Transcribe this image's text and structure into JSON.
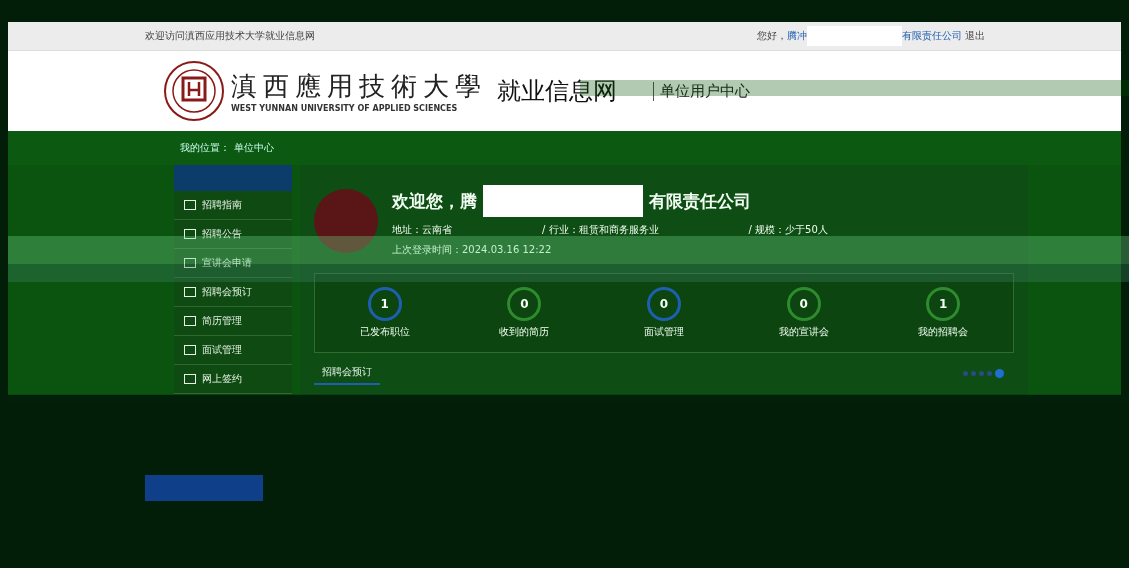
{
  "top_bar": {
    "welcome": "欢迎访问滇西应用技术大学就业信息网",
    "greeting": "您好，",
    "user_start": "腾冲",
    "user_end": "有限责任公司",
    "logout": "退出"
  },
  "header": {
    "school_name": "滇西應用技術大學",
    "school_name_en": "WEST YUNNAN UNIVERSITY OF APPLIED SCIENCES",
    "site_name": "就业信息网",
    "center": "单位用户中心"
  },
  "breadcrumb": {
    "label": "我的位置：",
    "current": "单位中心"
  },
  "sidebar": {
    "items": [
      {
        "label": "招聘指南",
        "selected": false
      },
      {
        "label": "招聘公告",
        "selected": false
      },
      {
        "label": "宣讲会申请",
        "selected": false
      },
      {
        "label": "招聘会预订",
        "selected": false
      },
      {
        "label": "简历管理",
        "selected": false
      },
      {
        "label": "面试管理",
        "selected": false
      },
      {
        "label": "网上签约",
        "selected": false
      }
    ]
  },
  "profile": {
    "welcome_start": "欢迎您，腾",
    "welcome_end": "有限责任公司",
    "address": "地址：云南省",
    "industry": "/ 行业：租赁和商务服务业",
    "scale": "/ 规模：少于50人",
    "last_login": "上次登录时间：2024.03.16 12:22"
  },
  "stats": [
    {
      "count": "1",
      "label": "已发布职位",
      "color": "#1f5fb0"
    },
    {
      "count": "0",
      "label": "收到的简历",
      "color": "#2e8b2e"
    },
    {
      "count": "0",
      "label": "面试管理",
      "color": "#1f5fb0"
    },
    {
      "count": "0",
      "label": "我的宣讲会",
      "color": "#2e8b2e"
    },
    {
      "count": "1",
      "label": "我的招聘会",
      "color": "#2e8b2e"
    }
  ],
  "tabs": [
    {
      "label": "招聘会预订",
      "selected": true
    }
  ]
}
